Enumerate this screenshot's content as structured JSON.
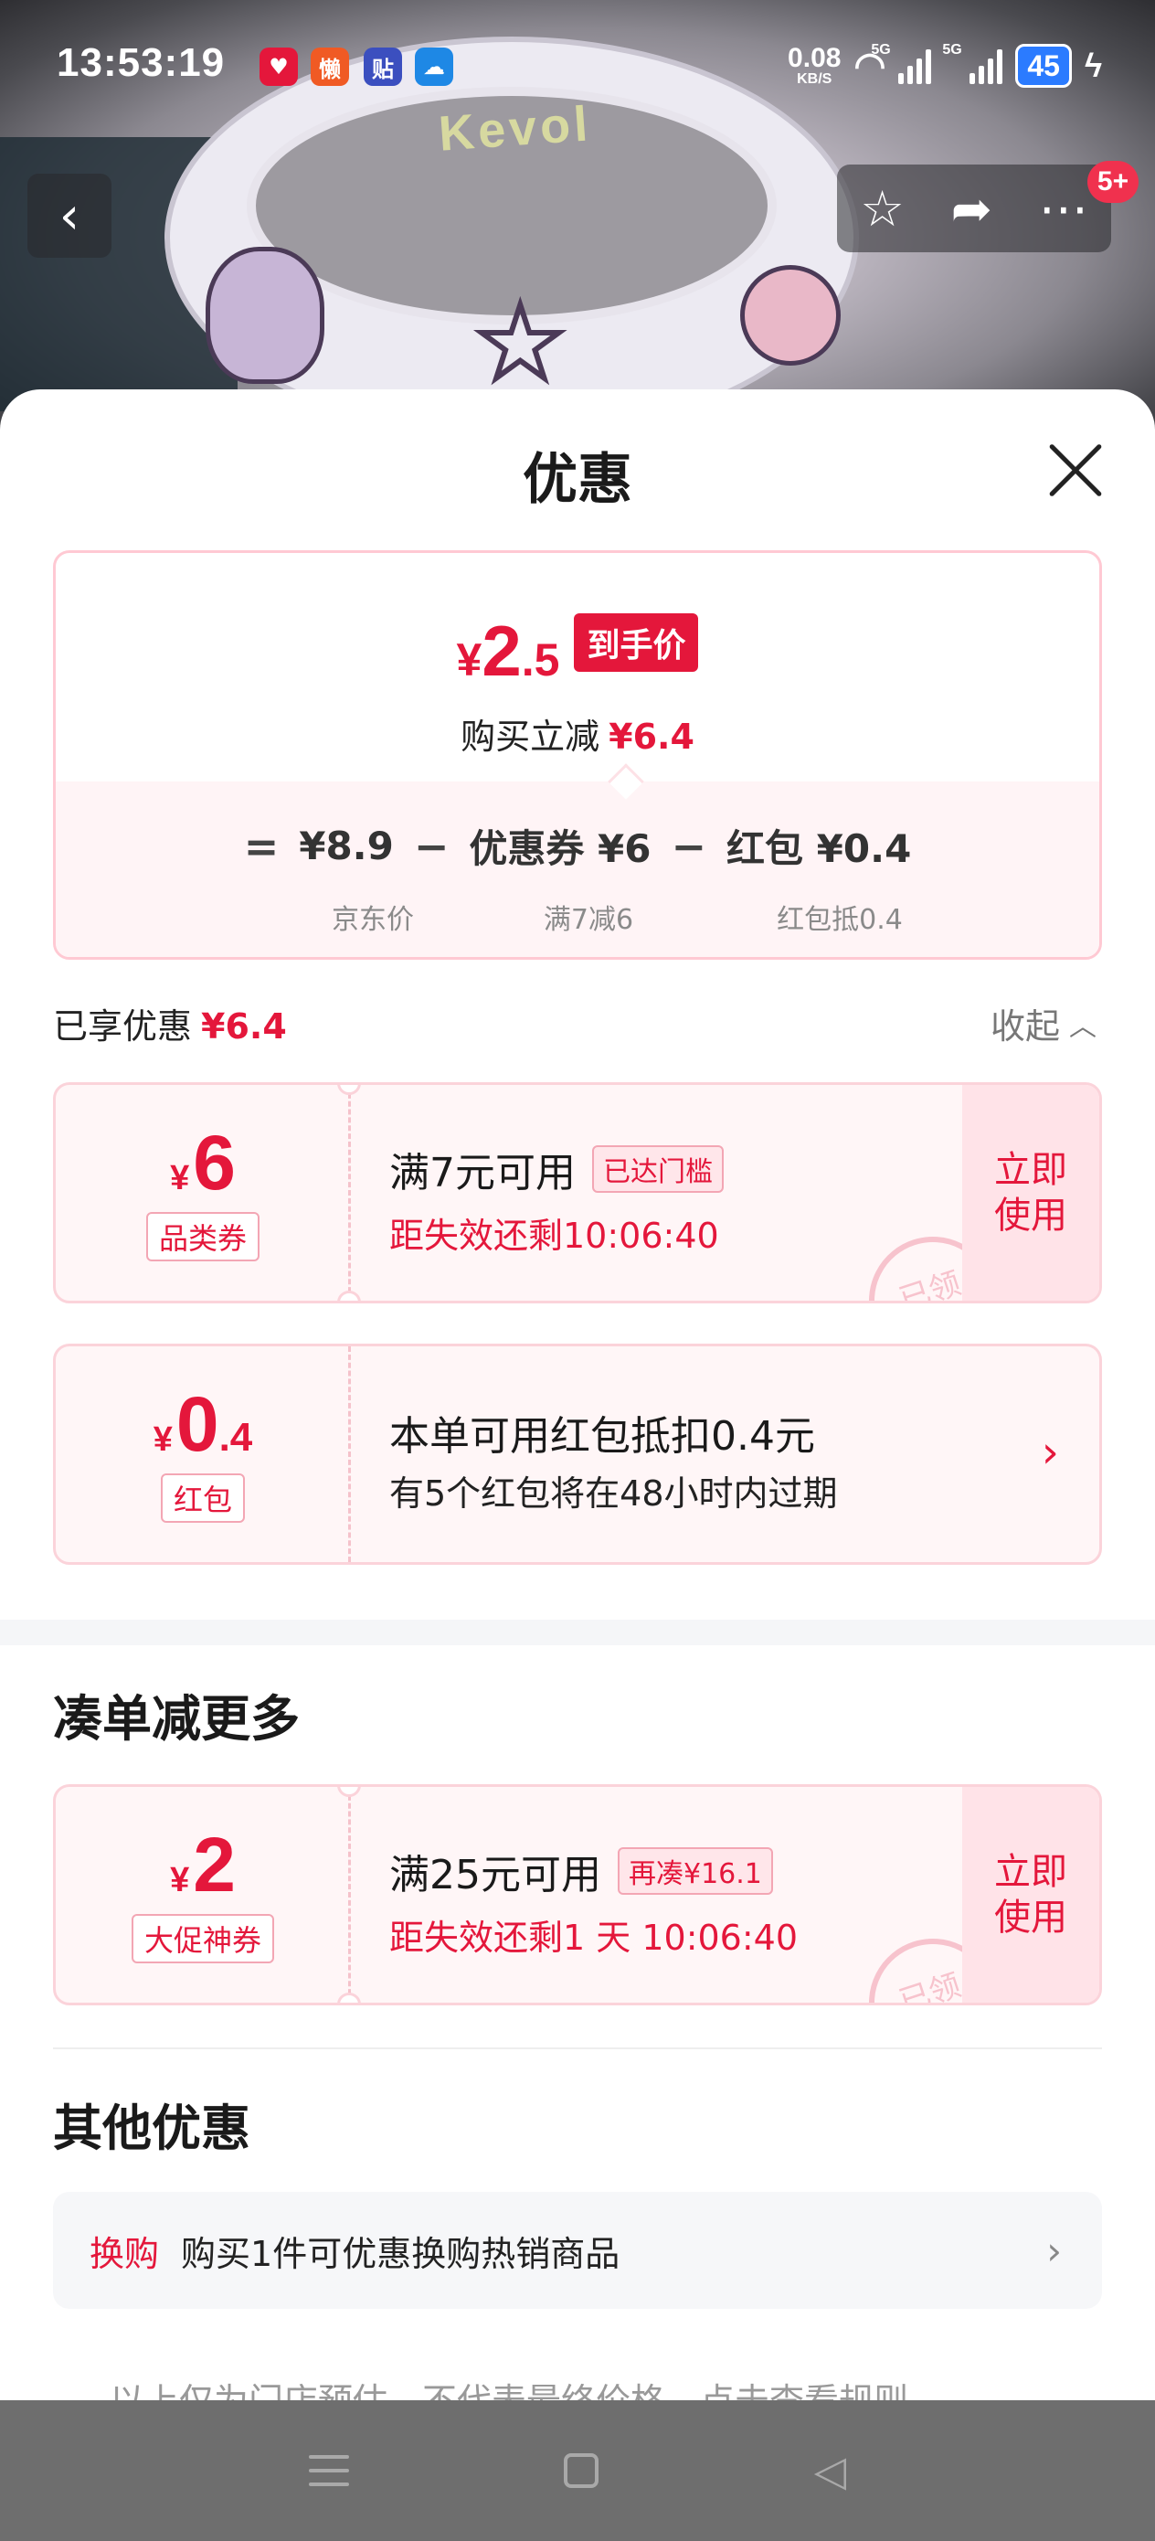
{
  "status_bar": {
    "time": "13:53:19",
    "net_speed_value": "0.08",
    "net_speed_unit": "KB/S",
    "sim1_label": "5G",
    "sim2_label": "5G",
    "battery": "45",
    "apps": [
      {
        "name": "jd-app-icon",
        "color": "#e4173b"
      },
      {
        "name": "lazy-app-icon",
        "color": "#f05a24"
      },
      {
        "name": "tie-app-icon",
        "color": "#3b4fbf"
      },
      {
        "name": "cloud-app-icon",
        "color": "#1e88e5"
      }
    ]
  },
  "product_image": {
    "logo_text": "Kevol"
  },
  "nav": {
    "badge": "5+"
  },
  "sheet": {
    "title": "优惠"
  },
  "summary": {
    "yen": "¥",
    "final_int": "2",
    "final_dec": ".5",
    "final_tag": "到手价",
    "reduce_label": "购买立减",
    "reduce_amount": "¥6.4",
    "formula": {
      "eq": "=",
      "price": "¥8.9",
      "minus1": "−",
      "coupon": "优惠券 ¥6",
      "minus2": "−",
      "redpacket": "红包 ¥0.4"
    },
    "subs": {
      "price": "京东价",
      "coupon": "满7减6",
      "redpacket": "红包抵0.4"
    }
  },
  "enjoyed": {
    "label": "已享优惠",
    "amount": "¥6.4",
    "collapse": "收起"
  },
  "coupons": [
    {
      "yen": "¥",
      "int": "6",
      "dec": "",
      "tag": "品类券",
      "title": "满7元可用",
      "pill": "已达门槛",
      "sub": "距失效还剩10:06:40",
      "button": "立即\n使用",
      "stamp": "已领"
    },
    {
      "yen": "¥",
      "int": "0",
      "dec": ".4",
      "tag": "红包",
      "title": "本单可用红包抵扣0.4元",
      "sub": "有5个红包将在48小时内过期"
    }
  ],
  "more_section": {
    "title": "凑单减更多",
    "coupon": {
      "yen": "¥",
      "int": "2",
      "dec": "",
      "tag": "大促神券",
      "title": "满25元可用",
      "pill": "再凑¥16.1",
      "sub": "距失效还剩1 天 10:06:40",
      "button": "立即\n使用",
      "stamp": "已领"
    }
  },
  "other_section": {
    "title": "其他优惠",
    "item_tag": "换购",
    "item_text": "购买1件可优惠换购热销商品"
  },
  "disclaimer": "以上仅为门店预估，不代表最终价格，点击查看规则"
}
